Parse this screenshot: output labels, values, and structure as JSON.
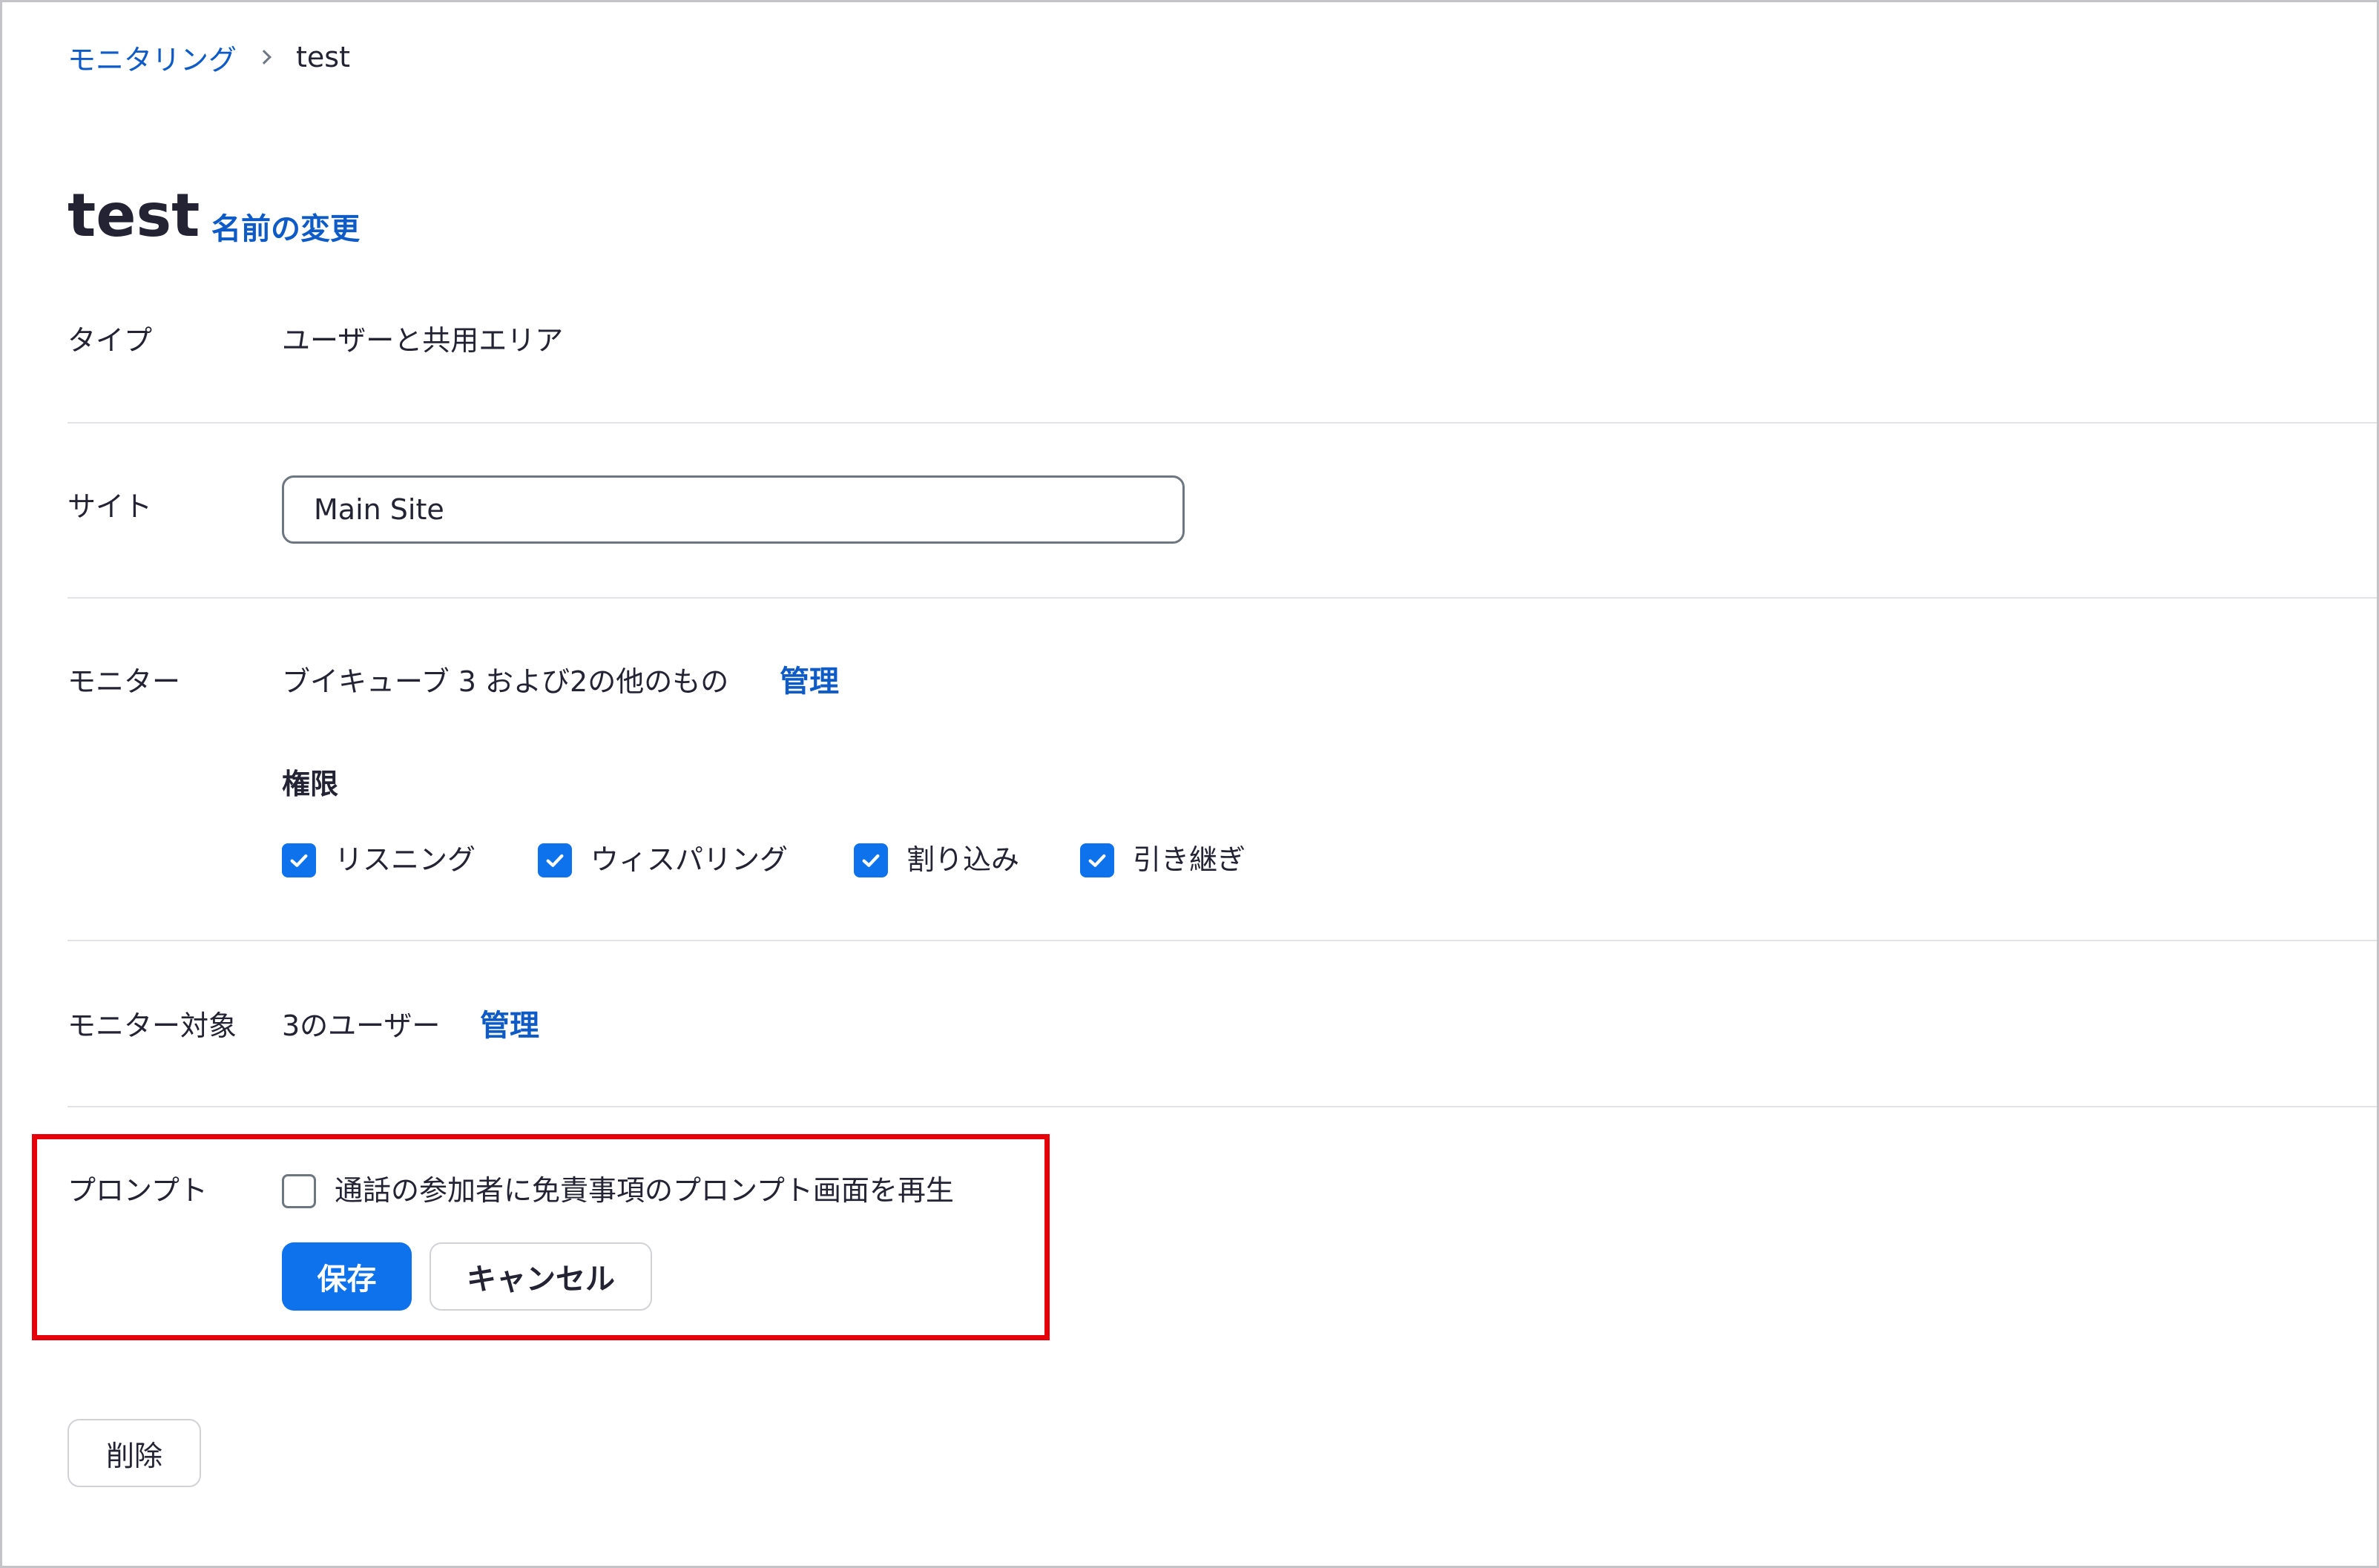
{
  "breadcrumb": {
    "parent": "モニタリング",
    "current": "test"
  },
  "header": {
    "title": "test",
    "rename_link": "名前の変更"
  },
  "type_row": {
    "label": "タイプ",
    "value": "ユーザーと共用エリア"
  },
  "site_row": {
    "label": "サイト",
    "value": "Main Site"
  },
  "monitor_row": {
    "label": "モニター",
    "value": "ブイキューブ 3 および2の他のもの",
    "manage_link": "管理",
    "permissions_title": "権限",
    "permissions": [
      {
        "label": "リスニング",
        "checked": true
      },
      {
        "label": "ウィスパリング",
        "checked": true
      },
      {
        "label": "割り込み",
        "checked": true
      },
      {
        "label": "引き継ぎ",
        "checked": true
      }
    ]
  },
  "target_row": {
    "label": "モニター対象",
    "value": "3のユーザー",
    "manage_link": "管理"
  },
  "prompt_row": {
    "label": "プロンプト",
    "checkbox_label": "通話の参加者に免責事項のプロンプト画面を再生",
    "checked": false
  },
  "actions": {
    "save_label": "保存",
    "cancel_label": "キャンセル",
    "delete_label": "削除"
  },
  "colors": {
    "accent": "#0e72ed",
    "link": "#0e5bc7",
    "highlight": "#e5000a",
    "text": "#232333"
  }
}
